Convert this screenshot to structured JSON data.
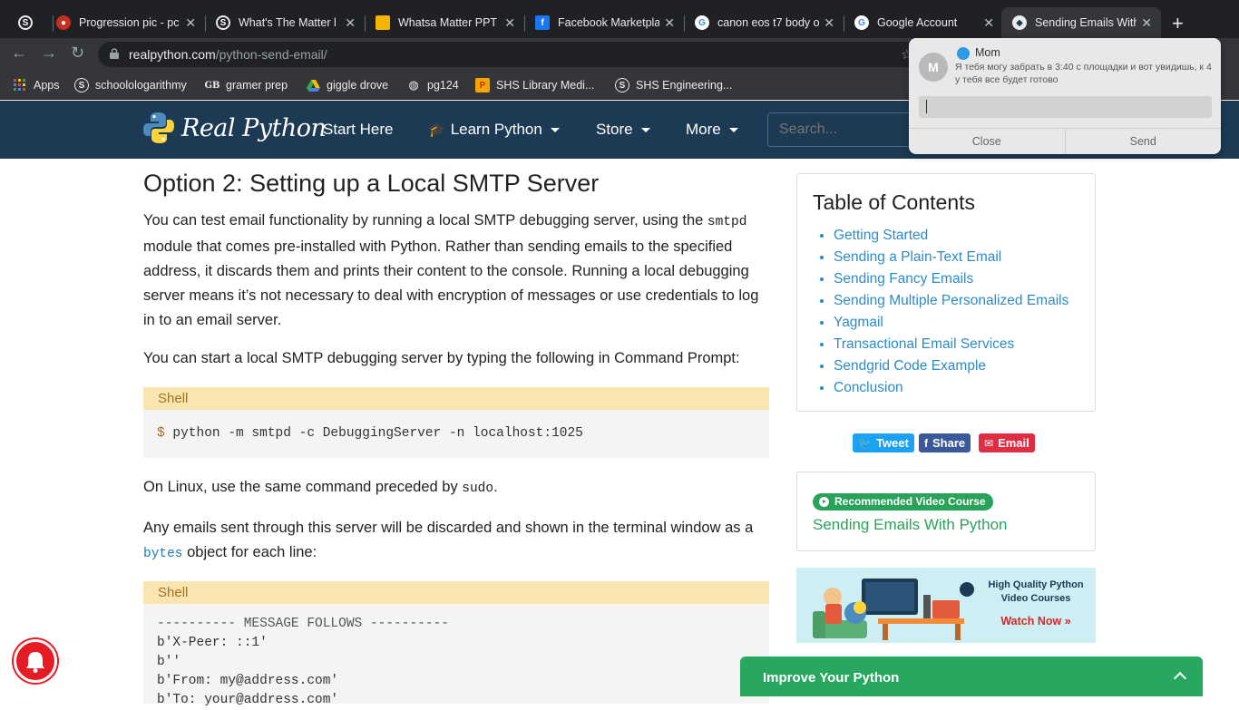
{
  "browser": {
    "tabs": [
      {
        "title": "Progression pic - pc",
        "icon": "reddit-icon",
        "color": "#c52f1f"
      },
      {
        "title": "What's The Matter l",
        "icon": "schoology-icon",
        "color": "#202124"
      },
      {
        "title": "Whatsa Matter PPT",
        "icon": "slides-icon",
        "color": "#f4b400"
      },
      {
        "title": "Facebook Marketpla",
        "icon": "facebook-icon",
        "color": "#1877f2"
      },
      {
        "title": "canon eos t7 body o",
        "icon": "google-icon",
        "color": "#ffffff"
      },
      {
        "title": "Google Account",
        "icon": "google-icon",
        "color": "#ffffff"
      },
      {
        "title": "Sending Emails With",
        "icon": "python-icon",
        "color": "#ffffff",
        "active": true
      }
    ],
    "url_host": "realpython.com",
    "url_path": "/python-send-email/",
    "bookmarks": [
      {
        "label": "Apps",
        "icon": "apps-icon"
      },
      {
        "label": "schoolologarithmy",
        "icon": "schoology-icon"
      },
      {
        "label": "gramer prep",
        "icon": "gb-icon"
      },
      {
        "label": "giggle drove",
        "icon": "drive-icon"
      },
      {
        "label": "pg124",
        "icon": "globe-icon"
      },
      {
        "label": "SHS Library Medi...",
        "icon": "library-icon"
      },
      {
        "label": "SHS Engineering...",
        "icon": "schoology-icon"
      }
    ]
  },
  "site": {
    "logo_text": "Real Python",
    "nav": [
      {
        "label": "Start Here",
        "dropdown": false
      },
      {
        "label": "Learn Python",
        "dropdown": true
      },
      {
        "label": "Store",
        "dropdown": true
      },
      {
        "label": "More",
        "dropdown": true
      }
    ],
    "search_placeholder": "Search..."
  },
  "article": {
    "heading": "Option 2: Setting up a Local SMTP Server",
    "p1_before": "You can test email functionality by running a local SMTP debugging server, using the ",
    "p1_code": "smtpd",
    "p1_after": " module that comes pre-installed with Python. Rather than sending emails to the specified address, it discards them and prints their content to the console. Running a local debugging server means it’s not necessary to deal with encryption of messages or use credentials to log in to an email server.",
    "p2": "You can start a local SMTP debugging server by typing the following in Command Prompt:",
    "code1_label": "Shell",
    "code1_prompt": "$",
    "code1": "python -m smtpd -c DebuggingServer -n localhost:1025",
    "p3_before": "On Linux, use the same command preceded by ",
    "p3_code": "sudo",
    "p3_after": ".",
    "p4_before": "Any emails sent through this server will be discarded and shown in the terminal window as a ",
    "p4_code": "bytes",
    "p4_after": " object for each line:",
    "code2_label": "Shell",
    "code2_lines": [
      "---------- MESSAGE FOLLOWS ----------",
      "b'X-Peer: ::1'",
      "b''",
      "b'From: my@address.com'",
      "b'To: your@address.com'"
    ]
  },
  "toc": {
    "title": "Table of Contents",
    "items": [
      "Getting Started",
      "Sending a Plain-Text Email",
      "Sending Fancy Emails",
      "Sending Multiple Personalized Emails",
      "Yagmail",
      "Transactional Email Services",
      "Sendgrid Code Example",
      "Conclusion"
    ]
  },
  "share": {
    "tweet": "Tweet",
    "share": "Share",
    "email": "Email",
    "colors": {
      "tweet": "#1da1f2",
      "share": "#3b5998",
      "email": "#dd2e44"
    }
  },
  "recommended": {
    "badge": "Recommended Video Course",
    "title": "Sending Emails With Python"
  },
  "banner": {
    "headline": "High Quality Python Video Courses",
    "cta": "Watch Now »"
  },
  "improve_bar": {
    "label": "Improve Your Python"
  },
  "notification": {
    "sender": "Mom",
    "avatar_letter": "M",
    "message": "Я тебя могу забрать в 3:40 с площадки и вот увидишь, к 4 у тебя все будет готово",
    "reply_value": "",
    "close_label": "Close",
    "send_label": "Send"
  }
}
